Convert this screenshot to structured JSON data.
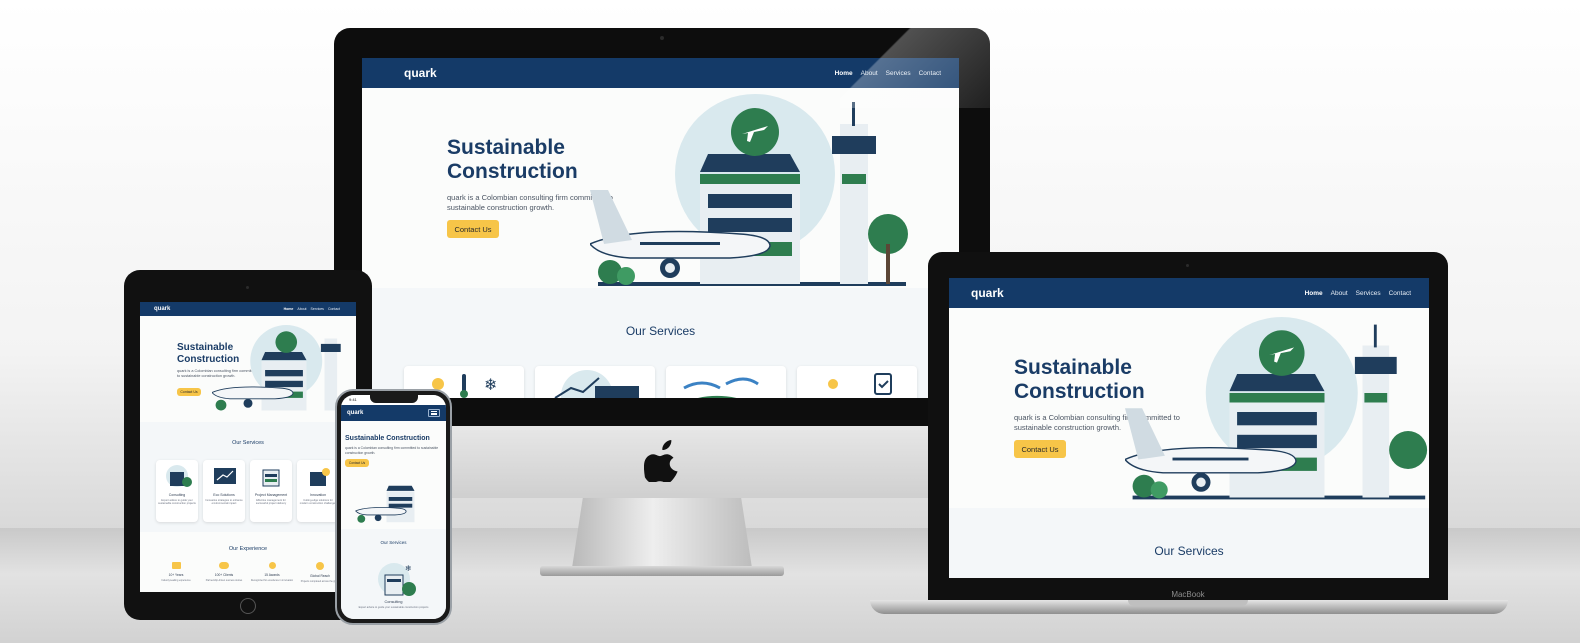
{
  "site": {
    "logo": "quark",
    "nav": [
      "Home",
      "About",
      "Services",
      "Contact"
    ],
    "active_nav": "Home",
    "hero_title": "Sustainable Construction",
    "hero_title_line1": "Sustainable",
    "hero_title_line2": "Construction",
    "hero_subtitle": "quark is a Colombian consulting firm committed to sustainable construction growth.",
    "hero_subtitle_line1": "quark is a Colombian consulting firm committed to",
    "hero_subtitle_line2": "sustainable construction growth.",
    "cta": "Contact Us",
    "services_title": "Our Services",
    "services": [
      {
        "title": "Consulting",
        "desc": "Expert advice to guide your sustainable construction projects"
      },
      {
        "title": "Eco Solutions",
        "desc": "Innovative strategies to enhance environmental impact"
      },
      {
        "title": "Project Management",
        "desc": "Effective management for successful project delivery"
      },
      {
        "title": "Innovation",
        "desc": "Cutting-edge solutions for modern construction challenges"
      }
    ],
    "experience_title": "Our Experience",
    "experience": [
      {
        "title": "10+ Years",
        "desc": "Industry-leading experience"
      },
      {
        "title": "100+ Clients",
        "desc": "Partnership-driven success stories"
      },
      {
        "title": "15 Awards",
        "desc": "Recognized for excellence in innovation"
      },
      {
        "title": "Global Reach",
        "desc": "Projects completed across the globe"
      }
    ]
  },
  "phone": {
    "time": "9:41",
    "hero_title": "Sustainable Construction",
    "service_title": "Consulting",
    "service_desc": "Expert advice to guide your sustainable construction projects"
  },
  "laptop_label": "MacBook",
  "colors": {
    "navy": "#143a68",
    "accent_yellow": "#f7c548",
    "green": "#2e7d4f",
    "background": "#fbfcfb"
  }
}
